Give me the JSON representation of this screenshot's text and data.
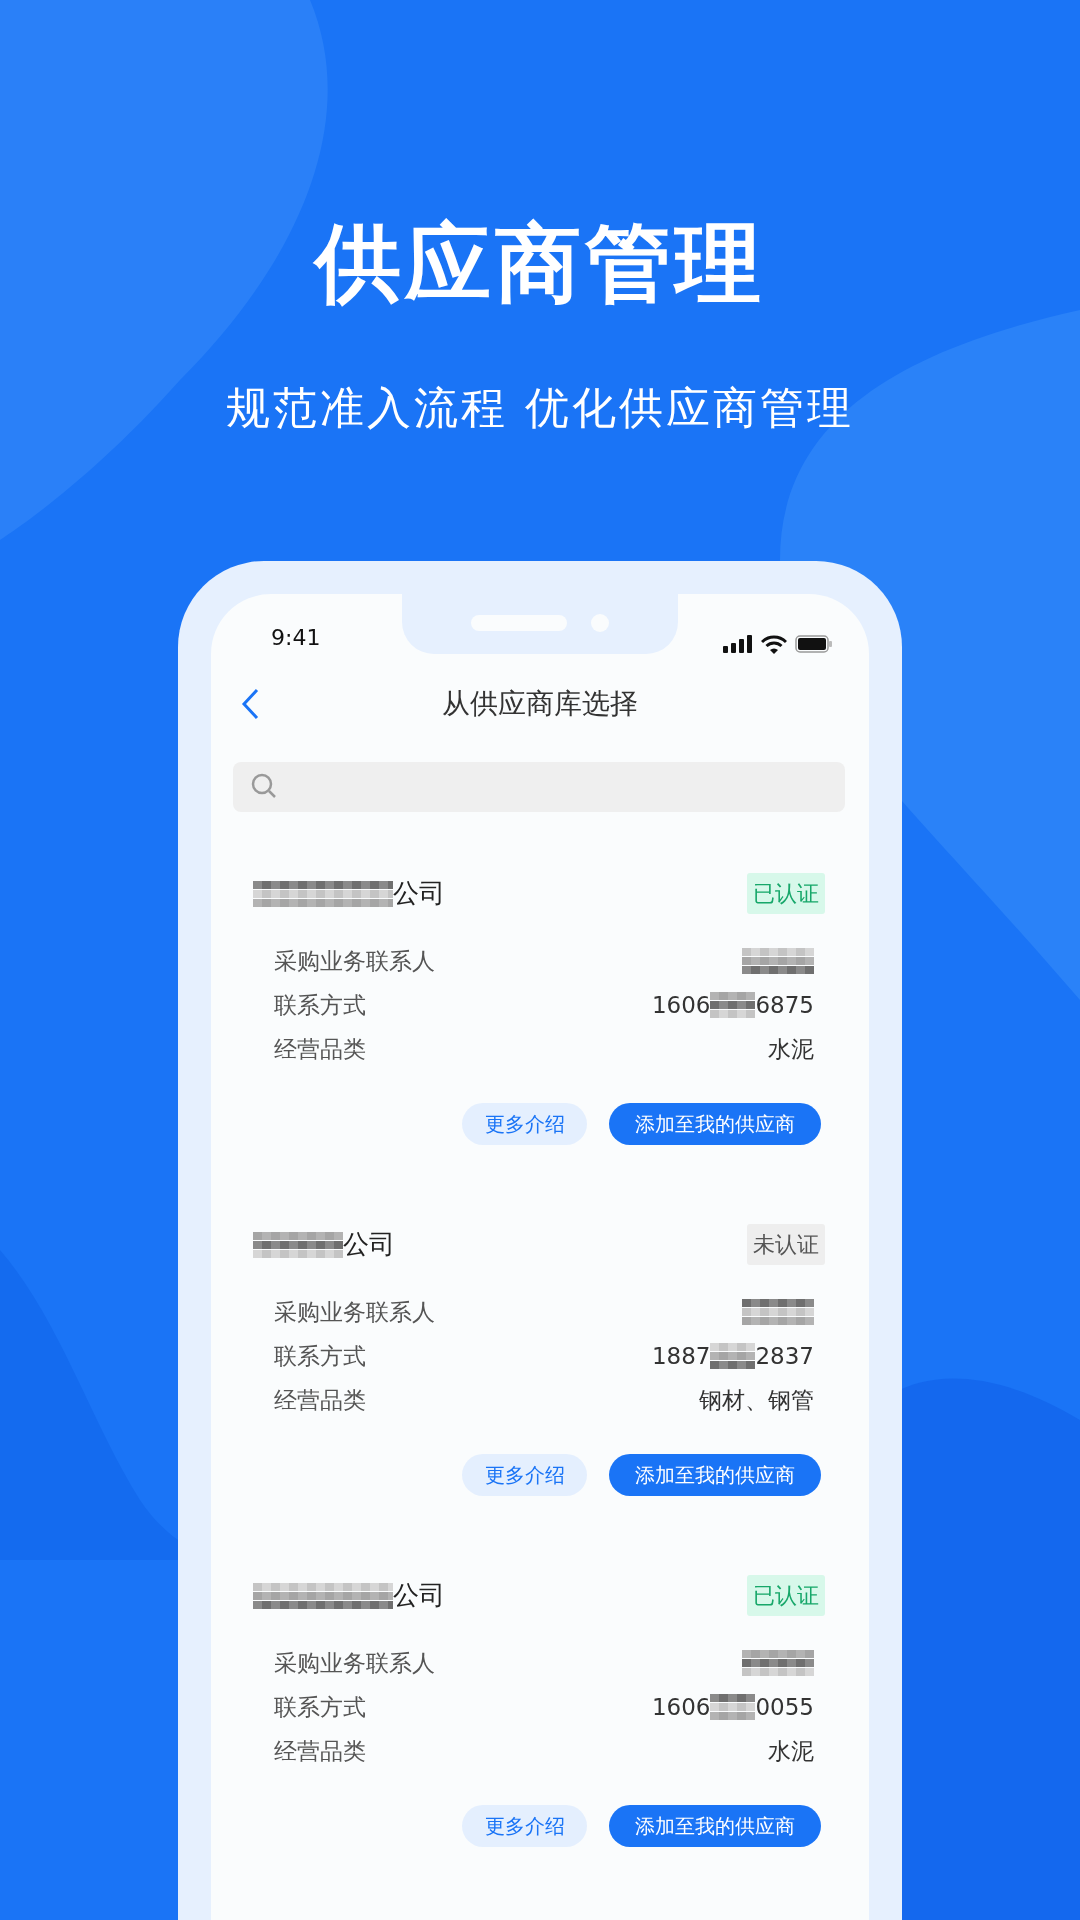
{
  "headline": "供应商管理",
  "subtitle": "规范准入流程 优化供应商管理",
  "status_bar": {
    "time": "9:41"
  },
  "header": {
    "title": "从供应商库选择"
  },
  "suppliers": [
    {
      "name_suffix": "公司",
      "certified": true,
      "badge": "已认证",
      "contact_label": "采购业务联系人",
      "phone_label": "联系方式",
      "phone_prefix": "1606",
      "phone_suffix": "6875",
      "category_label": "经营品类",
      "category": "水泥",
      "more_button": "更多介绍",
      "add_button": "添加至我的供应商"
    },
    {
      "name_suffix": "公司",
      "certified": false,
      "badge": "未认证",
      "contact_label": "采购业务联系人",
      "phone_label": "联系方式",
      "phone_prefix": "1887",
      "phone_suffix": "2837",
      "category_label": "经营品类",
      "category": "钢材、钢管",
      "more_button": "更多介绍",
      "add_button": "添加至我的供应商"
    },
    {
      "name_suffix": "公司",
      "certified": true,
      "badge": "已认证",
      "contact_label": "采购业务联系人",
      "phone_label": "联系方式",
      "phone_prefix": "1606",
      "phone_suffix": "0055",
      "category_label": "经营品类",
      "category": "水泥",
      "more_button": "更多介绍",
      "add_button": "添加至我的供应商"
    }
  ]
}
